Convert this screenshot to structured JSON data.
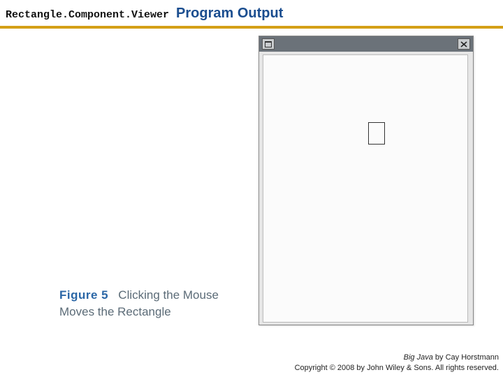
{
  "header": {
    "code_text": "Rectangle.Component.Viewer",
    "title_text": "Program Output"
  },
  "window": {
    "maximize_icon_name": "maximize-icon",
    "close_icon_name": "close-icon"
  },
  "figure": {
    "label": "Figure 5",
    "caption": "Clicking the Mouse Moves the Rectangle"
  },
  "footer": {
    "book_title": "Big Java",
    "byline": " by Cay Horstmann",
    "copyright": "Copyright © 2008 by John Wiley & Sons.  All rights reserved."
  }
}
